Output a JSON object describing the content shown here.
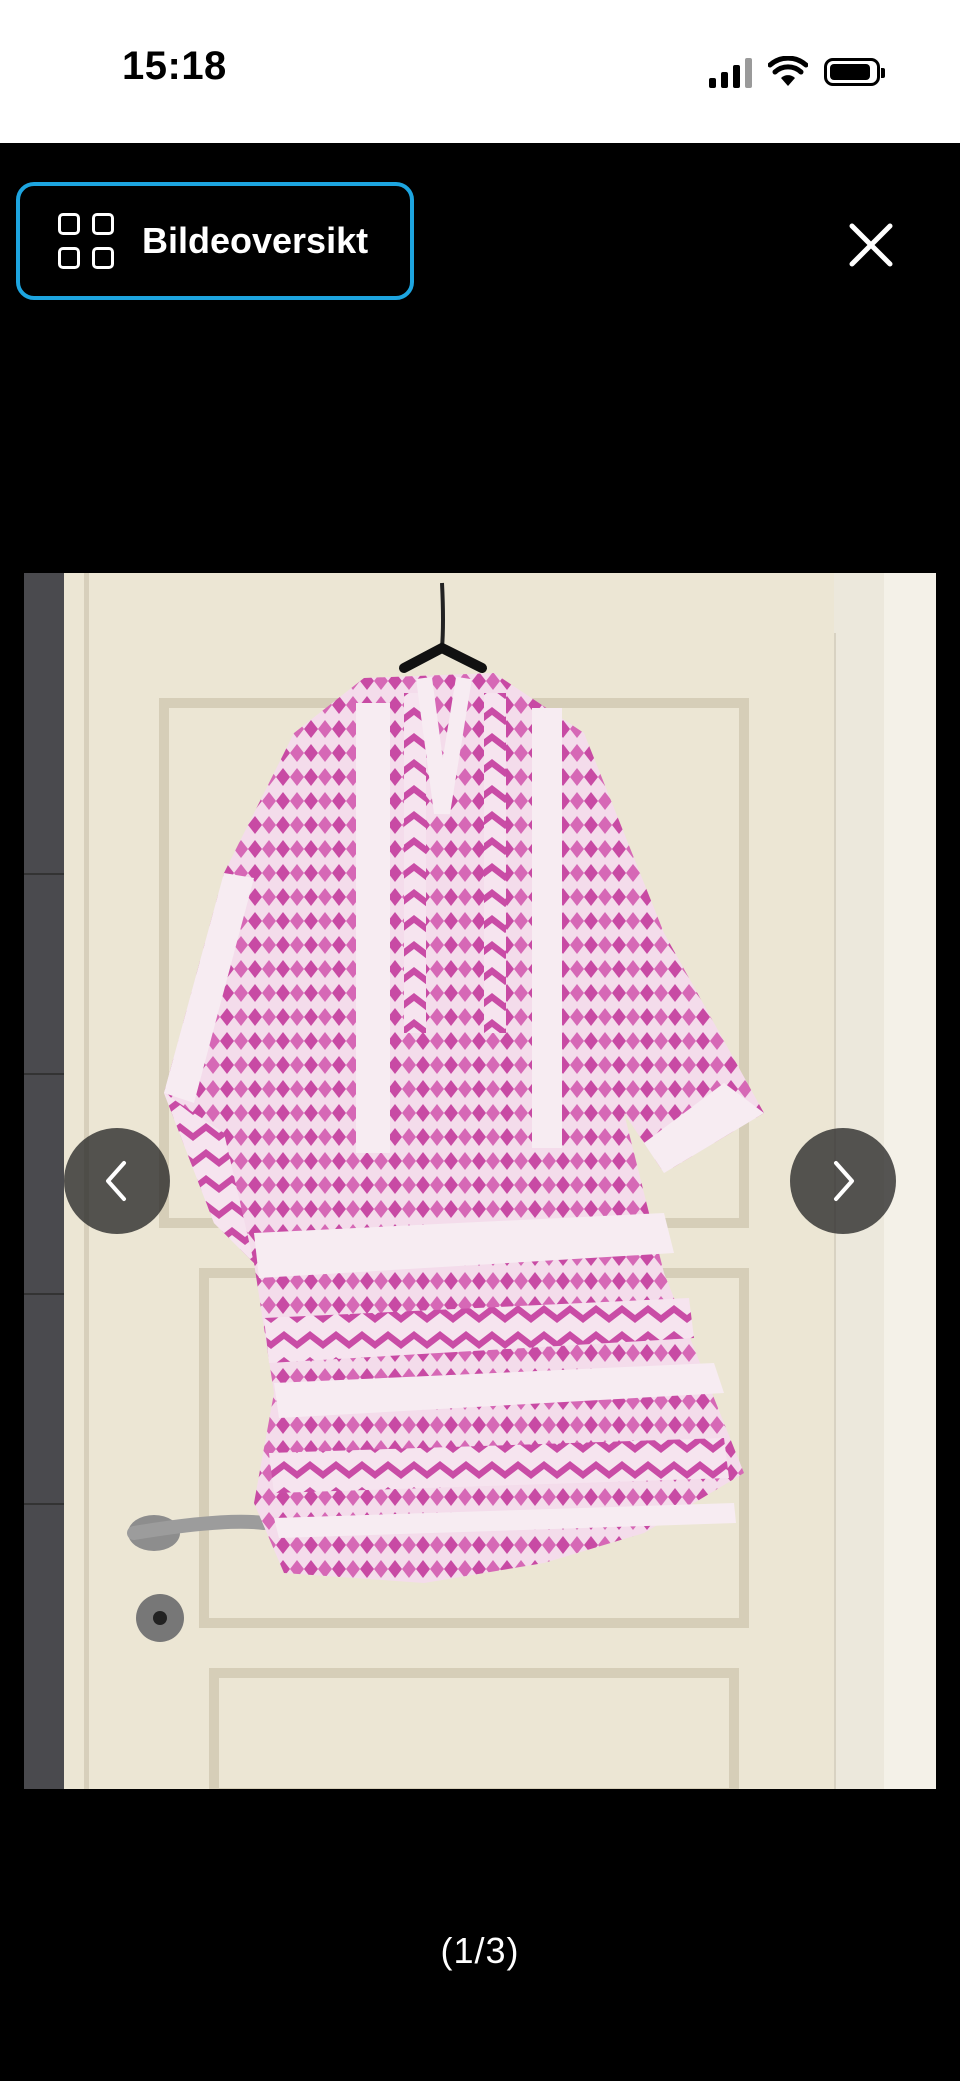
{
  "status_bar": {
    "time": "15:18",
    "icons": [
      "cellular-signal-icon",
      "wifi-icon",
      "battery-icon"
    ]
  },
  "toolbar": {
    "overview_label": "Bildeoversikt",
    "overview_icon": "grid-icon",
    "close_icon": "close-icon",
    "accent_color": "#1da5e0"
  },
  "viewer": {
    "prev_icon": "chevron-left-icon",
    "next_icon": "chevron-right-icon",
    "counter": "(1/3)",
    "background_color": "#000000"
  }
}
